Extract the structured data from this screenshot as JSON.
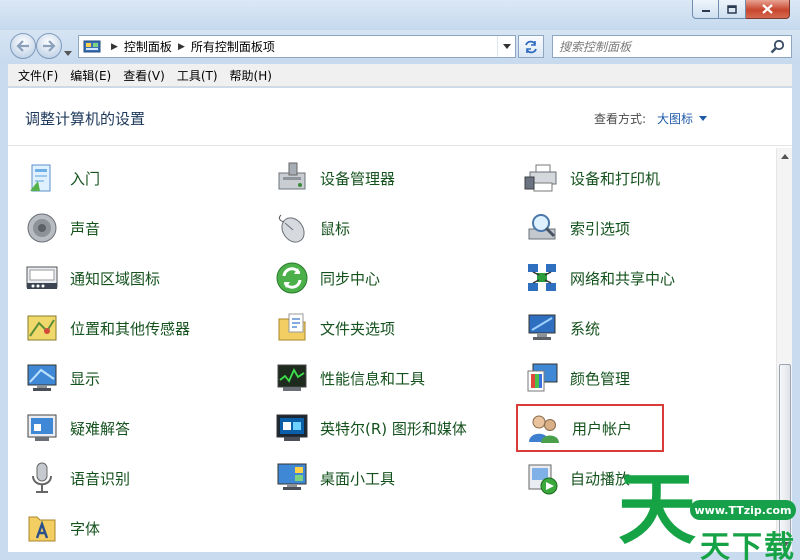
{
  "window": {
    "minimize_icon": "minimize-icon",
    "maximize_icon": "maximize-icon",
    "close_icon": "close-icon"
  },
  "address": {
    "crumbs": [
      "控制面板",
      "所有控制面板项"
    ]
  },
  "search": {
    "placeholder": "搜索控制面板"
  },
  "menu": [
    "文件(F)",
    "编辑(E)",
    "查看(V)",
    "工具(T)",
    "帮助(H)"
  ],
  "header": {
    "title": "调整计算机的设置",
    "view_label": "查看方式:",
    "view_value": "大图标"
  },
  "items": [
    {
      "label": "入门",
      "icon": "getting-started-icon"
    },
    {
      "label": "设备管理器",
      "icon": "device-manager-icon"
    },
    {
      "label": "设备和打印机",
      "icon": "devices-printers-icon"
    },
    {
      "label": "声音",
      "icon": "speaker-icon"
    },
    {
      "label": "鼠标",
      "icon": "mouse-icon"
    },
    {
      "label": "索引选项",
      "icon": "indexing-icon"
    },
    {
      "label": "通知区域图标",
      "icon": "notification-area-icon"
    },
    {
      "label": "同步中心",
      "icon": "sync-center-icon"
    },
    {
      "label": "网络和共享中心",
      "icon": "network-icon"
    },
    {
      "label": "位置和其他传感器",
      "icon": "location-sensors-icon"
    },
    {
      "label": "文件夹选项",
      "icon": "folder-options-icon"
    },
    {
      "label": "系统",
      "icon": "system-icon"
    },
    {
      "label": "显示",
      "icon": "display-icon"
    },
    {
      "label": "性能信息和工具",
      "icon": "performance-icon"
    },
    {
      "label": "颜色管理",
      "icon": "color-management-icon"
    },
    {
      "label": "疑难解答",
      "icon": "troubleshooting-icon"
    },
    {
      "label": "英特尔(R) 图形和媒体",
      "icon": "intel-graphics-icon"
    },
    {
      "label": "用户帐户",
      "icon": "user-accounts-icon",
      "highlighted": true
    },
    {
      "label": "语音识别",
      "icon": "microphone-icon"
    },
    {
      "label": "桌面小工具",
      "icon": "gadgets-icon"
    },
    {
      "label": "自动播放",
      "icon": "autoplay-icon"
    },
    {
      "label": "字体",
      "icon": "fonts-icon"
    }
  ],
  "watermark": {
    "url": "www.TTzip.com",
    "big": "天",
    "small": "天下载"
  },
  "colors": {
    "link_green": "#14521d",
    "highlight_red": "#d93a3a",
    "title_blue": "#1e395b",
    "accent_blue": "#1e5aa8"
  }
}
